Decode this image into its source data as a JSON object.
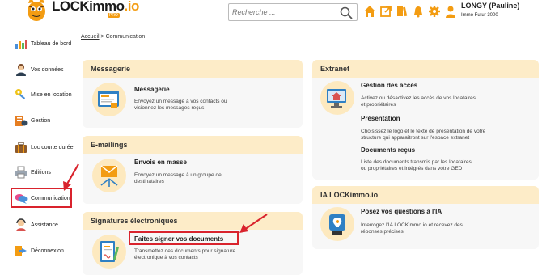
{
  "header": {
    "logo_text": "LOCKimmo",
    "logo_suffix": ".io",
    "logo_tag": "PRO",
    "search_placeholder": "Recherche ...",
    "user_name": "LONGY (Pauline)",
    "user_company": "Immo Futur 3000"
  },
  "sidebar": {
    "items": [
      {
        "label": "Tableau de bord",
        "icon": "dashboard-icon"
      },
      {
        "label": "Vos données",
        "icon": "user-data-icon"
      },
      {
        "label": "Mise en location",
        "icon": "keys-icon"
      },
      {
        "label": "Gestion",
        "icon": "management-icon"
      },
      {
        "label": "Loc courte durée",
        "icon": "suitcase-icon"
      },
      {
        "label": "Editions",
        "icon": "printer-icon"
      },
      {
        "label": "Communication",
        "icon": "chat-bubbles-icon"
      },
      {
        "label": "Assistance",
        "icon": "support-icon"
      },
      {
        "label": "Déconnexion",
        "icon": "logout-icon"
      }
    ],
    "active_index": 6
  },
  "breadcrumb": {
    "home": "Accueil",
    "separator": ">",
    "current": "Communication"
  },
  "cards": {
    "messagerie": {
      "header": "Messagerie",
      "items": [
        {
          "title": "Messagerie",
          "desc1": "Envoyez un message à vos contacts ou",
          "desc2": "visionnez les messages reçus"
        }
      ]
    },
    "emailings": {
      "header": "E-mailings",
      "items": [
        {
          "title": "Envois en masse",
          "desc1": "Envoyez un message à un groupe de",
          "desc2": "destinataires"
        }
      ]
    },
    "signatures": {
      "header": "Signatures électroniques",
      "items": [
        {
          "title": "Faites signer vos documents",
          "desc1": "Transmettez des documents pour signature",
          "desc2": "électronique à vos contacts"
        }
      ]
    },
    "extranet": {
      "header": "Extranet",
      "items": [
        {
          "title": "Gestion des accès",
          "desc1": "Activez ou désactivez les accès de vos locataires",
          "desc2": "et propriétaires"
        },
        {
          "title": "Présentation",
          "desc1": "Choisissez le logo et le texte de présentation de votre",
          "desc2": "structure qui apparaîtront sur l'espace extranet"
        },
        {
          "title": "Documents reçus",
          "desc1": "Liste des documents transmis par les locataires",
          "desc2": "ou propriétaires et intégrés dans votre GED"
        }
      ]
    },
    "ia": {
      "header": "IA LOCKimmo.io",
      "items": [
        {
          "title": "Posez vos questions à l'IA",
          "desc1": "Interrogez l'IA LOCKimmo.io et recevez des",
          "desc2": "réponses précises"
        }
      ]
    }
  },
  "colors": {
    "accent": "#f39c12",
    "card_header_bg": "#fdecc8",
    "card_bg": "#f7f7f7",
    "annotation_red": "#d9232d"
  }
}
